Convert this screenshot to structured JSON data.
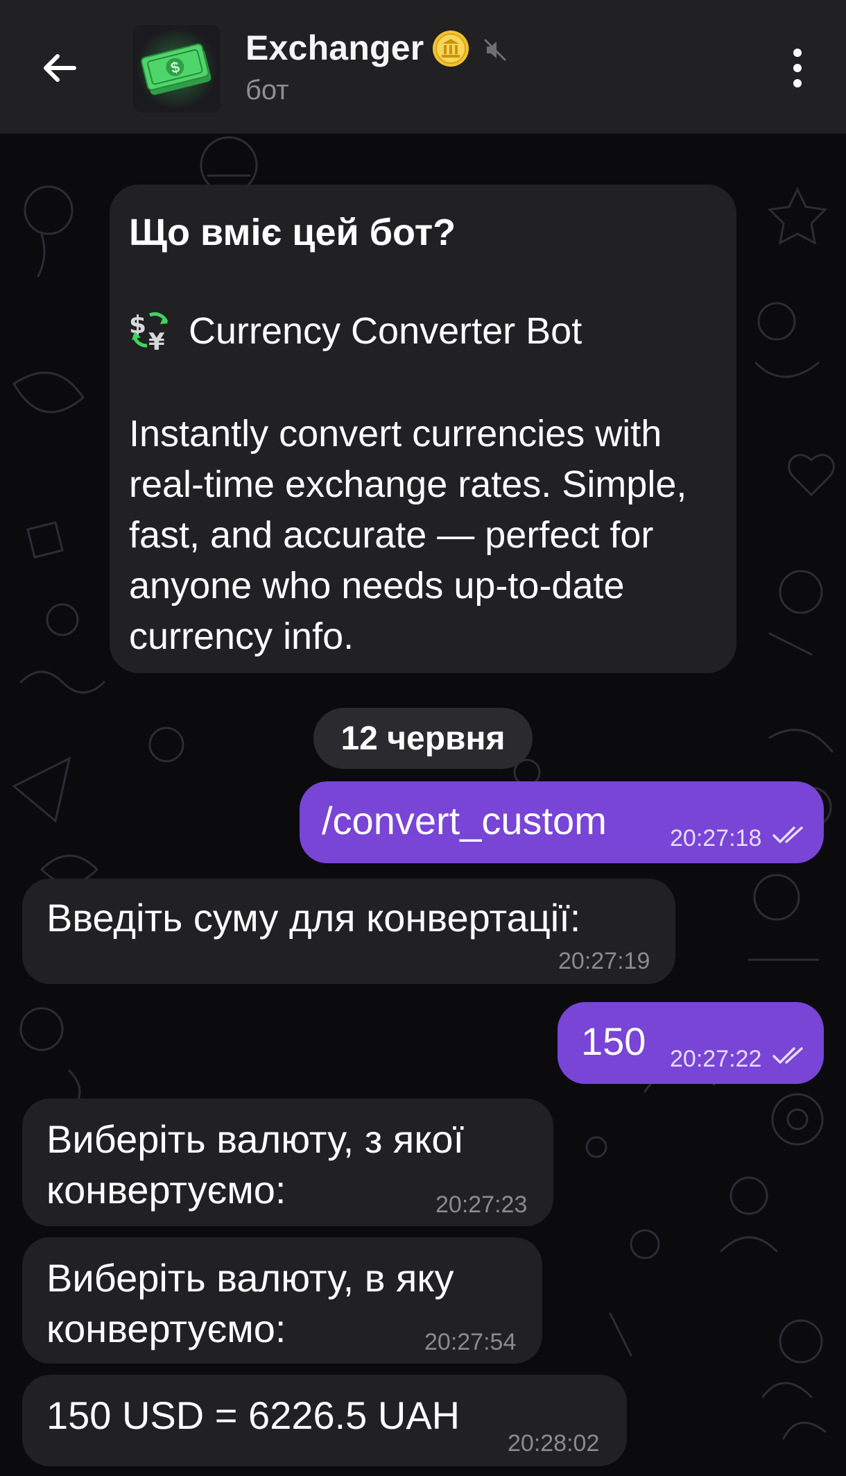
{
  "header": {
    "title": "Exchanger",
    "subtitle": "бот"
  },
  "intro": {
    "title": "Що вміє цей бот?",
    "heading": "Currency Converter Bot",
    "body": "Instantly convert currencies with real-time exchange rates. Simple, fast, and accurate — perfect for anyone who needs up-to-date currency info."
  },
  "date_separator": "12 червня",
  "messages": [
    {
      "direction": "out",
      "text": "/convert_custom",
      "time": "20:27:18",
      "status": "read"
    },
    {
      "direction": "in",
      "text": "Введіть суму для конвертації:",
      "time": "20:27:19"
    },
    {
      "direction": "out",
      "text": "150",
      "time": "20:27:22",
      "status": "read"
    },
    {
      "direction": "in",
      "line1": "Виберіть валюту, з якої",
      "line2": "конвертуємо:",
      "time": "20:27:23"
    },
    {
      "direction": "in",
      "line1": "Виберіть валюту, в яку",
      "line2": "конвертуємо:",
      "time": "20:27:54"
    },
    {
      "direction": "in",
      "text": "150 USD = 6226.5 UAH",
      "time": "20:28:02"
    }
  ],
  "icons": {
    "back": "arrow-left-icon",
    "badge": "coin-badge-icon",
    "muted": "muted-speaker-icon",
    "menu": "more-vertical-icon",
    "currency": "currency-exchange-icon",
    "read": "double-check-icon"
  },
  "colors": {
    "header_bg": "#212124",
    "chat_bg": "#0b0b0e",
    "incoming_bubble": "#212124",
    "outgoing_bubble": "#7845d6",
    "accent_gold": "#f2c230",
    "avatar_green": "#42d45c"
  }
}
